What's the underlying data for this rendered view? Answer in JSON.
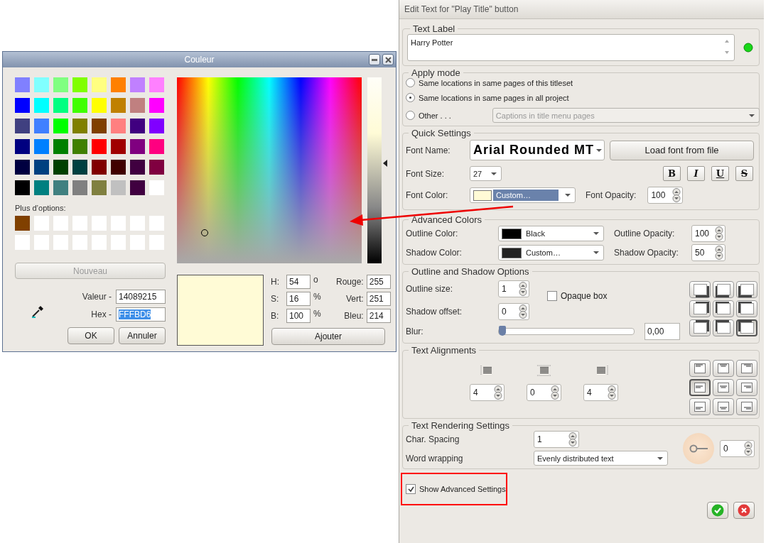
{
  "color_dialog": {
    "title": "Couleur",
    "basic_colors": [
      {
        "color": "#8080ff"
      },
      {
        "color": "#80ffff"
      },
      {
        "color": "#80ff80"
      },
      {
        "color": "#80ff00"
      },
      {
        "color": "#ffff80"
      },
      {
        "color": "#ff8000"
      },
      {
        "color": "#c080ff"
      },
      {
        "color": "#ff80ff"
      },
      {
        "color": "#0000ff"
      },
      {
        "color": "#00ffff"
      },
      {
        "color": "#00ff80"
      },
      {
        "color": "#40ff00"
      },
      {
        "color": "#ffff00"
      },
      {
        "color": "#c08000"
      },
      {
        "color": "#c08080"
      },
      {
        "color": "#ff00ff"
      },
      {
        "color": "#404080"
      },
      {
        "color": "#4080ff"
      },
      {
        "color": "#00ff00"
      },
      {
        "color": "#808000"
      },
      {
        "color": "#804000"
      },
      {
        "color": "#ff8080"
      },
      {
        "color": "#400080"
      },
      {
        "color": "#8000ff"
      },
      {
        "color": "#000080"
      },
      {
        "color": "#0080ff"
      },
      {
        "color": "#008000"
      },
      {
        "color": "#408000"
      },
      {
        "color": "#ff0000"
      },
      {
        "color": "#a00000"
      },
      {
        "color": "#800080"
      },
      {
        "color": "#ff0080"
      },
      {
        "color": "#000040"
      },
      {
        "color": "#004080"
      },
      {
        "color": "#004000"
      },
      {
        "color": "#004040"
      },
      {
        "color": "#800000"
      },
      {
        "color": "#400000"
      },
      {
        "color": "#400040"
      },
      {
        "color": "#800040"
      },
      {
        "color": "#000000"
      },
      {
        "color": "#008080"
      },
      {
        "color": "#408080"
      },
      {
        "color": "#808080"
      },
      {
        "color": "#808040"
      },
      {
        "color": "#c0c0c0"
      },
      {
        "color": "#400040"
      },
      {
        "color": "#ffffff"
      }
    ],
    "custom_label": "Plus d’options:",
    "custom_colors": [
      {
        "color": "#804000"
      },
      {
        "color": "#ffffff"
      },
      {
        "color": "#ffffff"
      },
      {
        "color": "#ffffff"
      },
      {
        "color": "#ffffff"
      },
      {
        "color": "#ffffff"
      },
      {
        "color": "#ffffff"
      },
      {
        "color": "#ffffff"
      },
      {
        "color": "#ffffff"
      },
      {
        "color": "#ffffff"
      },
      {
        "color": "#ffffff"
      },
      {
        "color": "#ffffff"
      },
      {
        "color": "#ffffff"
      },
      {
        "color": "#ffffff"
      },
      {
        "color": "#ffffff"
      },
      {
        "color": "#ffffff"
      }
    ],
    "new_button": {
      "label": "Nouveau",
      "disabled": true
    },
    "value_field": {
      "label": "Valeur -",
      "value": "14089215",
      "highlighted": false
    },
    "hex_field": {
      "label": "Hex -",
      "value": "FFFBD6",
      "highlighted": true
    },
    "ok_button": "OK",
    "cancel_button": "Annuler",
    "hsb": [
      {
        "label": "H:",
        "value": "54",
        "unit": "o"
      },
      {
        "label": "S:",
        "value": "16",
        "unit": "%"
      },
      {
        "label": "B:",
        "value": "100",
        "unit": "%"
      }
    ],
    "rgb": [
      {
        "label": "Rouge:",
        "value": "255"
      },
      {
        "label": "Vert:",
        "value": "251"
      },
      {
        "label": "Bleu:",
        "value": "214"
      }
    ],
    "add_button": "Ajouter"
  },
  "editor": {
    "title": "Edit Text for \"Play Title\" button",
    "text_label": {
      "title": "Text Label",
      "value": "Harry Potter"
    },
    "apply_mode": {
      "title": "Apply mode",
      "options": [
        {
          "label": "Same locations in same pages of this titleset",
          "selected": false
        },
        {
          "label": "Same locations in same pages in all project",
          "selected": true
        },
        {
          "label": "Other . . .",
          "selected": false
        }
      ],
      "other_dropdown": {
        "value": "Captions in title menu pages",
        "disabled": true
      }
    },
    "quick_settings": {
      "title": "Quick Settings",
      "font_name": {
        "label": "Font Name:",
        "value": "Arial Rounded MT"
      },
      "load_font_button": "Load font from file",
      "font_size": {
        "label": "Font Size:",
        "value": "27"
      },
      "style_buttons": [
        {
          "kind": "bold",
          "label": "B"
        },
        {
          "kind": "italic",
          "label": "I"
        },
        {
          "kind": "underline",
          "label": "U"
        },
        {
          "kind": "strike",
          "label": "S"
        }
      ],
      "font_color": {
        "label": "Font Color:",
        "value": "Custom…",
        "color": "#fffbd6"
      },
      "font_opacity": {
        "label": "Font Opacity:",
        "value": "100"
      }
    },
    "advanced_colors": {
      "title": "Advanced Colors",
      "rows": [
        {
          "label": "Outline Color:",
          "value": "Black",
          "color": "#000000",
          "opacity_label": "Outline Opacity:",
          "opacity": "100"
        },
        {
          "label": "Shadow Color:",
          "value": "Custom…",
          "color": "#222222",
          "opacity_label": "Shadow Opacity:",
          "opacity": "50"
        }
      ]
    },
    "outline_shadow": {
      "title": "Outline and Shadow  Options",
      "outline_size": {
        "label": "Outline size:",
        "value": "1"
      },
      "shadow_offset": {
        "label": "Shadow offset:",
        "value": "0"
      },
      "opaque_box": {
        "label": "Opaque box",
        "checked": false
      },
      "blur": {
        "label": "Blur:",
        "level": 0,
        "value": "0,00"
      },
      "shadow_styles": [
        {
          "selected": false
        },
        {
          "selected": false
        },
        {
          "selected": false
        },
        {
          "selected": false
        },
        {
          "selected": false
        },
        {
          "selected": false
        },
        {
          "selected": false
        },
        {
          "selected": false
        },
        {
          "selected": true
        }
      ]
    },
    "text_alignments": {
      "title": "Text Alignments",
      "margins": [
        {
          "kind": "left",
          "value": "4"
        },
        {
          "kind": "vertical",
          "value": "0"
        },
        {
          "kind": "right",
          "value": "4"
        }
      ],
      "alignments": [
        {
          "selected": false
        },
        {
          "selected": false
        },
        {
          "selected": false
        },
        {
          "selected": true
        },
        {
          "selected": false
        },
        {
          "selected": false
        },
        {
          "selected": false
        },
        {
          "selected": false
        },
        {
          "selected": false
        }
      ]
    },
    "text_rendering": {
      "title": "Text Rendering Settings",
      "char_spacing": {
        "label": "Char. Spacing",
        "value": "1"
      },
      "word_wrapping": {
        "label": "Word wrapping",
        "value": "Evenly distributed text"
      },
      "rotation": {
        "value": "0"
      }
    },
    "show_advanced": {
      "label": "Show Advanced Settings",
      "checked": true
    }
  }
}
